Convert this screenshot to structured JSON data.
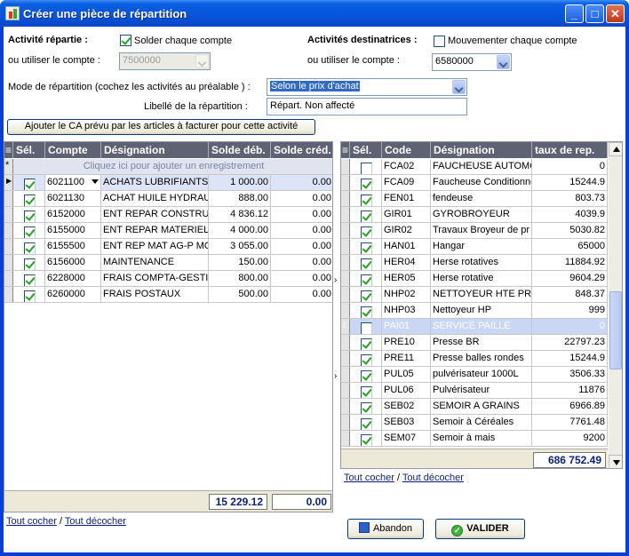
{
  "window": {
    "title": "Créer une pièce de répartition"
  },
  "top": {
    "activite_repartie_label": "Activité répartie :",
    "solder_label": "Solder chaque  compte",
    "ou_utiliser_left": "ou utiliser le compte :",
    "compte_left_value": "7500000",
    "activites_dest_label": "Activités  destinatrices :",
    "mouvementer_label": "Mouvementer  chaque  compte",
    "ou_utiliser_right": "ou utiliser le compte :",
    "compte_right_value": "6580000",
    "mode_label": "Mode de répartition (cochez les activités au préalable ) :",
    "mode_value": "Selon le prix d'achat",
    "libelle_label": "Libellé de la répartition :",
    "libelle_value": "Répart. Non affecté",
    "ajouter_ca_button": "Ajouter le CA prévu par les articles à facturer pour cette activité"
  },
  "left_grid": {
    "columns": [
      "Sél.",
      "Compte",
      "Désignation",
      "Solde déb.",
      "Solde créd."
    ],
    "new_row_hint": "Cliquez ici pour ajouter un enregistrement",
    "rows": [
      {
        "checked": true,
        "compte": "6021100",
        "designation": "ACHATS LUBRIFIANTS",
        "deb": "1 000.00",
        "cred": "0.00"
      },
      {
        "checked": true,
        "compte": "6021130",
        "designation": "ACHAT HUILE HYDRAUL",
        "deb": "888.00",
        "cred": "0.00"
      },
      {
        "checked": true,
        "compte": "6152000",
        "designation": "ENT REPAR CONSTRUCT",
        "deb": "4 836.12",
        "cred": "0.00"
      },
      {
        "checked": true,
        "compte": "6155000",
        "designation": "ENT REPAR MATERIEL",
        "deb": "4 000.00",
        "cred": "0.00"
      },
      {
        "checked": true,
        "compte": "6155500",
        "designation": "ENT REP MAT AG-P MO",
        "deb": "3 055.00",
        "cred": "0.00"
      },
      {
        "checked": true,
        "compte": "6156000",
        "designation": "MAINTENANCE",
        "deb": "150.00",
        "cred": "0.00"
      },
      {
        "checked": true,
        "compte": "6228000",
        "designation": "FRAIS COMPTA-GESTIO",
        "deb": "800.00",
        "cred": "0.00"
      },
      {
        "checked": true,
        "compte": "6260000",
        "designation": "FRAIS POSTAUX",
        "deb": "500.00",
        "cred": "0.00"
      }
    ],
    "total_deb": "15 229.12",
    "total_cred": "0.00",
    "tout_cocher": "Tout cocher",
    "separator": "/",
    "tout_decocher": "Tout décocher"
  },
  "right_grid": {
    "columns": [
      "Sél.",
      "Code",
      "Désignation",
      "taux de rep."
    ],
    "rows": [
      {
        "checked": false,
        "code": "FCA02",
        "designation": "FAUCHEUSE AUTOMO",
        "taux": "0"
      },
      {
        "checked": true,
        "code": "FCA09",
        "designation": "Faucheuse Conditionne",
        "taux": "15244.9"
      },
      {
        "checked": true,
        "code": "FEN01",
        "designation": "fendeuse",
        "taux": "803.73"
      },
      {
        "checked": true,
        "code": "GIR01",
        "designation": "GYROBROYEUR",
        "taux": "4039.9"
      },
      {
        "checked": true,
        "code": "GIR02",
        "designation": "Travaux Broyeur de pr",
        "taux": "5030.82"
      },
      {
        "checked": true,
        "code": "HAN01",
        "designation": "Hangar",
        "taux": "65000"
      },
      {
        "checked": true,
        "code": "HER04",
        "designation": "Herse rotatives",
        "taux": "11884.92"
      },
      {
        "checked": true,
        "code": "HER05",
        "designation": "Herse rotative",
        "taux": "9604.29"
      },
      {
        "checked": true,
        "code": "NHP02",
        "designation": "NETTOYEUR HTE PRES",
        "taux": "848.37"
      },
      {
        "checked": true,
        "code": "NHP03",
        "designation": "Nettoyeur HP",
        "taux": "999"
      },
      {
        "checked": false,
        "code": "PAI01",
        "designation": "SERVICE PAILLE",
        "taux": "0"
      },
      {
        "checked": true,
        "code": "PRE10",
        "designation": "Presse BR",
        "taux": "22797.23"
      },
      {
        "checked": true,
        "code": "PRE11",
        "designation": "Presse balles rondes",
        "taux": "15244.9"
      },
      {
        "checked": true,
        "code": "PUL05",
        "designation": "pulvérisateur 1000L",
        "taux": "3506.33"
      },
      {
        "checked": true,
        "code": "PUL06",
        "designation": "Pulvérisateur",
        "taux": "11876"
      },
      {
        "checked": true,
        "code": "SEB02",
        "designation": "SEMOIR A GRAINS",
        "taux": "6966.89"
      },
      {
        "checked": true,
        "code": "SEB03",
        "designation": "Semoir à Céréales",
        "taux": "7761.48"
      },
      {
        "checked": true,
        "code": "SEM07",
        "designation": "Semoir à mais",
        "taux": "9200"
      }
    ],
    "total_taux": "686 752.49",
    "tout_cocher": "Tout cocher",
    "separator": "/",
    "tout_decocher": "Tout décocher"
  },
  "buttons": {
    "abandon": "Abandon",
    "valider": "VALIDER"
  }
}
